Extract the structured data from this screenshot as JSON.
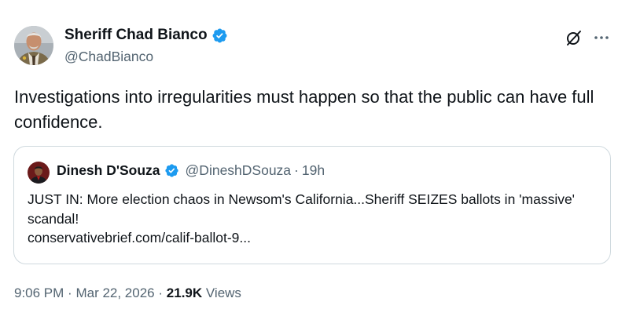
{
  "author": {
    "name": "Sheriff Chad Bianco",
    "handle": "@ChadBianco"
  },
  "tweet": {
    "text": "Investigations into irregularities must happen so that the public can have full confidence."
  },
  "quoted_tweet": {
    "author_name": "Dinesh D'Souza",
    "author_handle": "@DineshDSouza",
    "separator": "·",
    "time_ago": "19h",
    "text": "JUST IN: More election chaos in Newsom's California...Sheriff SEIZES ballots in 'massive' scandal!",
    "link": "conservativebrief.com/calif-ballot-9..."
  },
  "meta": {
    "time": "9:06 PM",
    "separator": "·",
    "date": "Mar 22, 2026",
    "views_count": "21.9K",
    "views_label": "Views"
  },
  "colors": {
    "verified_blue": "#1d9bf0",
    "secondary_text": "#536471",
    "primary_text": "#0f1419",
    "border": "#cfd9de"
  },
  "icons": {
    "grok": "grok-icon",
    "more": "more-icon",
    "verified": "verified-badge-icon"
  }
}
